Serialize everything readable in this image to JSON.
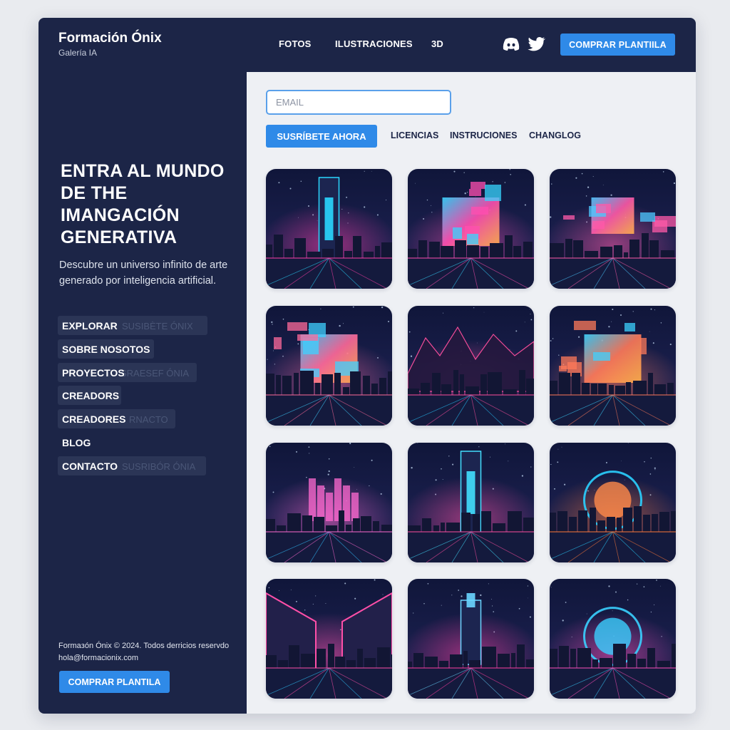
{
  "brand": {
    "title": "Formación Ónix",
    "subtitle": "Galería IA"
  },
  "topnav": {
    "items": [
      "FOTOS",
      "ILUSTRACIONES",
      "3D"
    ],
    "cta": "COMPRAR PLANTIILA"
  },
  "social": [
    "discord-icon",
    "twitter-icon"
  ],
  "hero": {
    "title": "ENTRA AL MUNDO DE THE IMANGACIÓN GENERATIVA",
    "subtitle": "Descubre un universo infinito de arte generado por inteligencia artificial."
  },
  "sidebar": {
    "menu": [
      {
        "label": "EXPLORAR",
        "ghost": "SUSIBÈTE ÓNIX"
      },
      {
        "label": "SOBRE NOSOTOS",
        "ghost": ""
      },
      {
        "label": "PROYECTOS",
        "ghost": "SRAESEF ÓNIA"
      },
      {
        "label": "CREADORS",
        "ghost": ""
      },
      {
        "label": "CREADORES",
        "ghost": "RNACTO"
      },
      {
        "label": "BLOG",
        "ghost": ""
      },
      {
        "label": "CONTACTO",
        "ghost": "SUSRIBÓR ÓNIA"
      }
    ],
    "footer_copy": "Formaзón Ónix © 2024. Todos derricios reservdo",
    "footer_email": "hola@formacionix.com",
    "cta": "COMPRAR PLANTILA"
  },
  "main": {
    "email_placeholder": "EMAIL",
    "subscribe": "SUSRÍBETE AHORA",
    "links": [
      "LICENCIAS",
      "INSTRUCIONES",
      "CHANGLOG"
    ]
  },
  "gallery": [
    {
      "kind": "tower",
      "c1": "#ff3fa8",
      "c2": "#2ad8ff"
    },
    {
      "kind": "panel",
      "c1": "#ff4fb0",
      "c2": "#37d6ff"
    },
    {
      "kind": "blocks",
      "c1": "#ff5aa8",
      "c2": "#4cc8ff"
    },
    {
      "kind": "screens",
      "c1": "#ff6a9a",
      "c2": "#3fd0ff"
    },
    {
      "kind": "mountains",
      "c1": "#ff4f9e",
      "c2": "#28c8ff"
    },
    {
      "kind": "glowpanel",
      "c1": "#ff7a5a",
      "c2": "#3cd2ff"
    },
    {
      "kind": "skyline",
      "c1": "#ff6ad0",
      "c2": "#33c2ff"
    },
    {
      "kind": "portal",
      "c1": "#ff4fa0",
      "c2": "#43e0ff"
    },
    {
      "kind": "orb",
      "c1": "#ff7a3a",
      "c2": "#2ad0ff"
    },
    {
      "kind": "bridge",
      "c1": "#ff4fa8",
      "c2": "#30c8ff"
    },
    {
      "kind": "beacon",
      "c1": "#ff3fa0",
      "c2": "#6ad6ff"
    },
    {
      "kind": "ring",
      "c1": "#ff4fb8",
      "c2": "#3ad0ff"
    }
  ]
}
